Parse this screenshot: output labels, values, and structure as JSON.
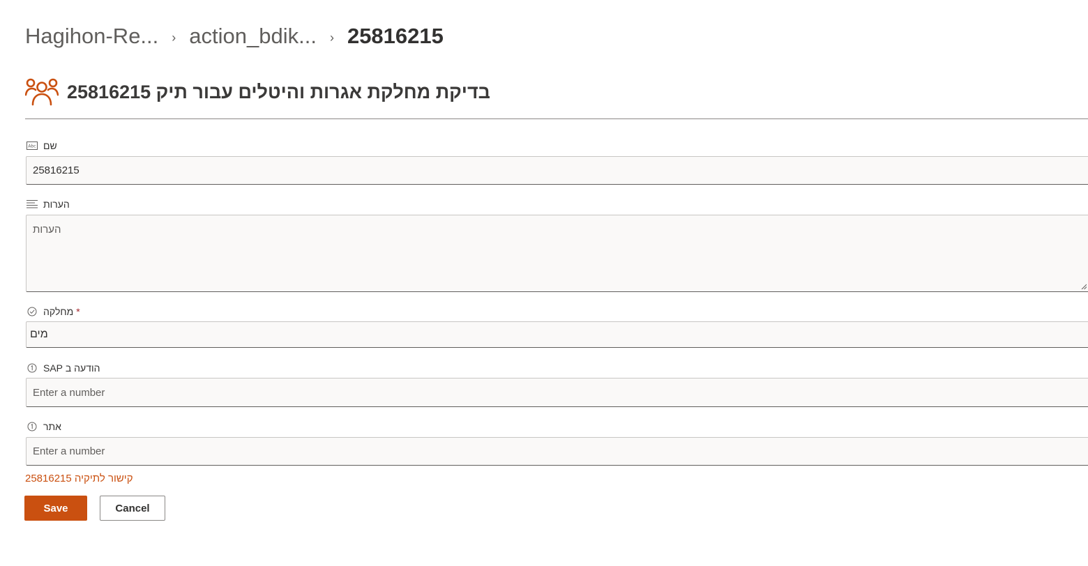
{
  "breadcrumb": {
    "items": [
      {
        "label": "Hagihon-Re..."
      },
      {
        "label": "action_bdik..."
      },
      {
        "label": "25816215"
      }
    ]
  },
  "form": {
    "title": "בדיקת מחלקת אגרות והיטלים עבור תיק 25816215",
    "icon": "group-people-icon",
    "accent_color": "#ca5010",
    "fields": [
      {
        "label": "שם",
        "icon": "text-field-icon",
        "value": "25816215",
        "placeholder": ""
      },
      {
        "label": "הערות",
        "icon": "multiline-text-icon",
        "value": "",
        "placeholder": "הערות"
      },
      {
        "label": "מחלקה",
        "icon": "choice-check-icon",
        "required": true,
        "required_mark": "*",
        "value": "מים",
        "placeholder": ""
      },
      {
        "label": "הודעה ב SAP",
        "icon": "number-field-icon",
        "value": "",
        "placeholder": "Enter a number"
      },
      {
        "label": "אתר",
        "icon": "number-field-icon",
        "value": "",
        "placeholder": "Enter a number"
      }
    ],
    "link": {
      "label": "קישור לתיקיה 25816215"
    },
    "buttons": {
      "save_label": "Save",
      "cancel_label": "Cancel"
    }
  }
}
